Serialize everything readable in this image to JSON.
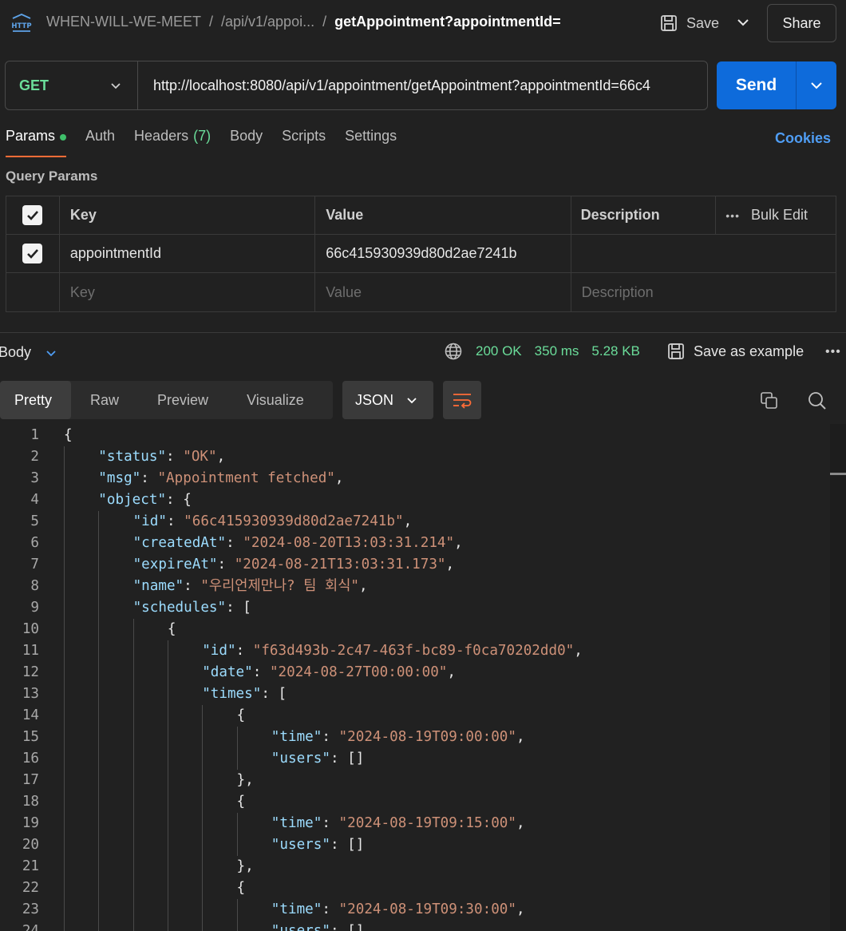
{
  "breadcrumb": {
    "collection": "WHEN-WILL-WE-MEET",
    "folder": "/api/v1/appoi...",
    "request": "getAppointment?appointmentId=",
    "separator": "/"
  },
  "toolbar": {
    "save_label": "Save",
    "share_label": "Share"
  },
  "request": {
    "method": "GET",
    "url": "http://localhost:8080/api/v1/appointment/getAppointment?appointmentId=66c4",
    "send_label": "Send"
  },
  "tabs": [
    {
      "label": "Params",
      "active": true
    },
    {
      "label": "Auth"
    },
    {
      "label": "Headers",
      "count": "(7)"
    },
    {
      "label": "Body"
    },
    {
      "label": "Scripts"
    },
    {
      "label": "Settings"
    }
  ],
  "cookies_label": "Cookies",
  "query_params": {
    "title": "Query Params",
    "headers": {
      "key": "Key",
      "value": "Value",
      "description": "Description",
      "bulk_edit": "Bulk Edit"
    },
    "rows": [
      {
        "checked": true,
        "key": "appointmentId",
        "value": "66c415930939d80d2ae7241b",
        "description": ""
      }
    ],
    "placeholders": {
      "key": "Key",
      "value": "Value",
      "description": "Description"
    }
  },
  "response": {
    "body_label": "Body",
    "status": "200 OK",
    "time": "350 ms",
    "size": "5.28 KB",
    "save_example_label": "Save as example",
    "view_tabs": [
      "Pretty",
      "Raw",
      "Preview",
      "Visualize"
    ],
    "active_view": "Pretty",
    "format": "JSON",
    "lines": [
      [
        [
          "p",
          "{"
        ]
      ],
      [
        [
          "k",
          "\"status\""
        ],
        [
          "p",
          ": "
        ],
        [
          "s",
          "\"OK\""
        ],
        [
          "p",
          ","
        ]
      ],
      [
        [
          "k",
          "\"msg\""
        ],
        [
          "p",
          ": "
        ],
        [
          "s",
          "\"Appointment fetched\""
        ],
        [
          "p",
          ","
        ]
      ],
      [
        [
          "k",
          "\"object\""
        ],
        [
          "p",
          ": {"
        ]
      ],
      [
        [
          "k",
          "\"id\""
        ],
        [
          "p",
          ": "
        ],
        [
          "s",
          "\"66c415930939d80d2ae7241b\""
        ],
        [
          "p",
          ","
        ]
      ],
      [
        [
          "k",
          "\"createdAt\""
        ],
        [
          "p",
          ": "
        ],
        [
          "s",
          "\"2024-08-20T13:03:31.214\""
        ],
        [
          "p",
          ","
        ]
      ],
      [
        [
          "k",
          "\"expireAt\""
        ],
        [
          "p",
          ": "
        ],
        [
          "s",
          "\"2024-08-21T13:03:31.173\""
        ],
        [
          "p",
          ","
        ]
      ],
      [
        [
          "k",
          "\"name\""
        ],
        [
          "p",
          ": "
        ],
        [
          "s",
          "\"우리언제만나? 팀 회식\""
        ],
        [
          "p",
          ","
        ]
      ],
      [
        [
          "k",
          "\"schedules\""
        ],
        [
          "p",
          ": ["
        ]
      ],
      [
        [
          "p",
          "{"
        ]
      ],
      [
        [
          "k",
          "\"id\""
        ],
        [
          "p",
          ": "
        ],
        [
          "s",
          "\"f63d493b-2c47-463f-bc89-f0ca70202dd0\""
        ],
        [
          "p",
          ","
        ]
      ],
      [
        [
          "k",
          "\"date\""
        ],
        [
          "p",
          ": "
        ],
        [
          "s",
          "\"2024-08-27T00:00:00\""
        ],
        [
          "p",
          ","
        ]
      ],
      [
        [
          "k",
          "\"times\""
        ],
        [
          "p",
          ": ["
        ]
      ],
      [
        [
          "p",
          "{"
        ]
      ],
      [
        [
          "k",
          "\"time\""
        ],
        [
          "p",
          ": "
        ],
        [
          "s",
          "\"2024-08-19T09:00:00\""
        ],
        [
          "p",
          ","
        ]
      ],
      [
        [
          "k",
          "\"users\""
        ],
        [
          "p",
          ": []"
        ]
      ],
      [
        [
          "p",
          "},"
        ]
      ],
      [
        [
          "p",
          "{"
        ]
      ],
      [
        [
          "k",
          "\"time\""
        ],
        [
          "p",
          ": "
        ],
        [
          "s",
          "\"2024-08-19T09:15:00\""
        ],
        [
          "p",
          ","
        ]
      ],
      [
        [
          "k",
          "\"users\""
        ],
        [
          "p",
          ": []"
        ]
      ],
      [
        [
          "p",
          "},"
        ]
      ],
      [
        [
          "p",
          "{"
        ]
      ],
      [
        [
          "k",
          "\"time\""
        ],
        [
          "p",
          ": "
        ],
        [
          "s",
          "\"2024-08-19T09:30:00\""
        ],
        [
          "p",
          ","
        ]
      ],
      [
        [
          "k",
          "\"users\""
        ],
        [
          "p",
          ": []"
        ]
      ]
    ],
    "indents": [
      0,
      1,
      1,
      1,
      2,
      2,
      2,
      2,
      2,
      3,
      4,
      4,
      4,
      5,
      6,
      6,
      5,
      5,
      6,
      6,
      5,
      5,
      6,
      6
    ]
  },
  "colors": {
    "accent": "#ff6c37",
    "send": "#0e6bdb",
    "success": "#6bdd9a",
    "link": "#4f9df4",
    "json_key": "#9cdcfe",
    "json_string": "#ce9178"
  }
}
